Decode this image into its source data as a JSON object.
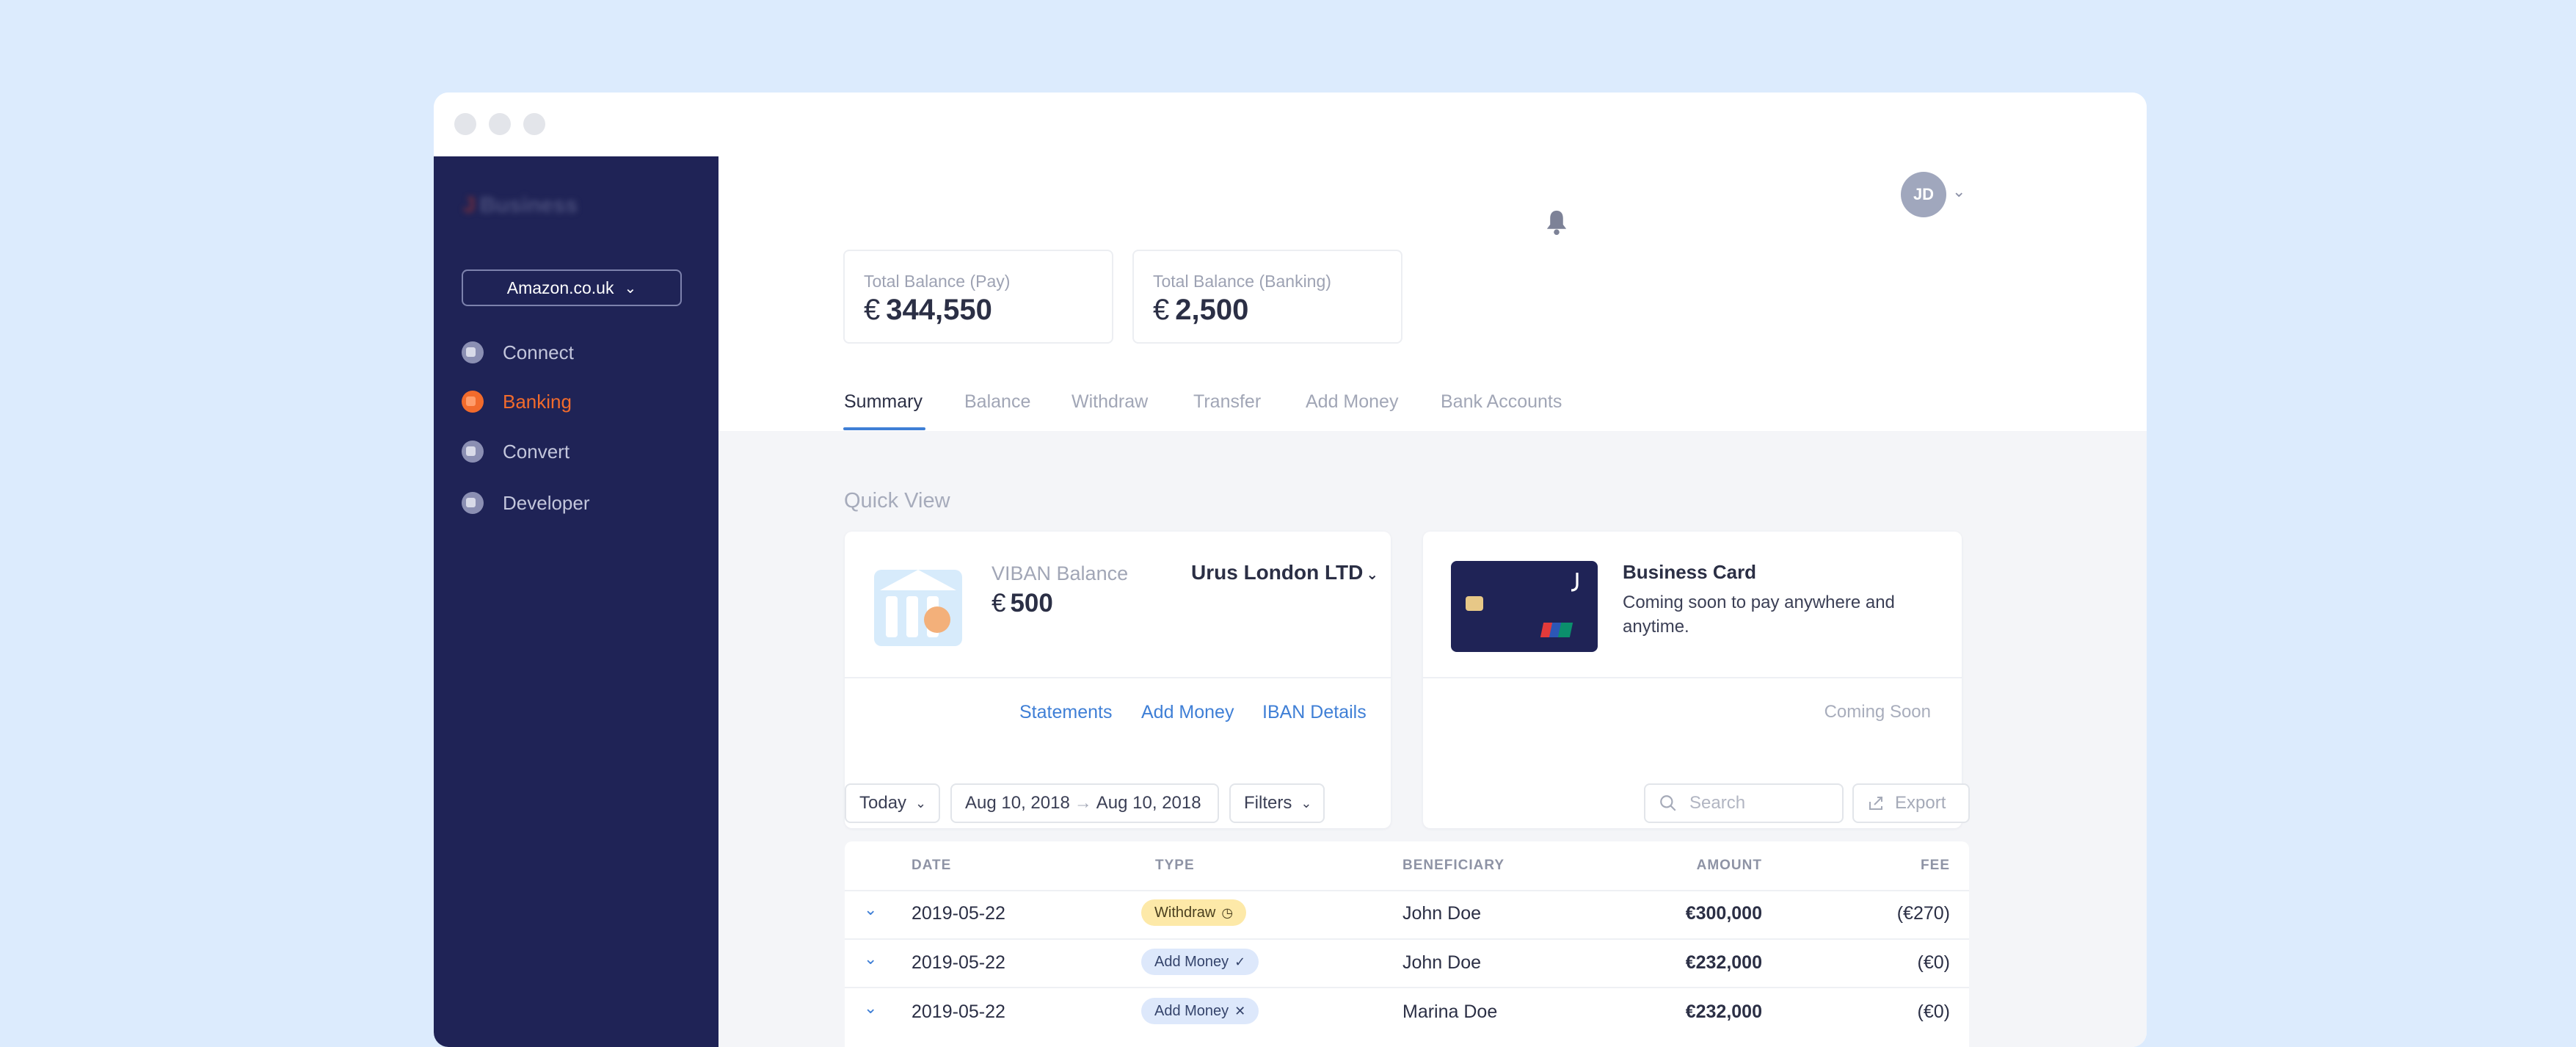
{
  "window": {
    "controls": [
      "close",
      "minimize",
      "maximize"
    ]
  },
  "sidebar": {
    "logo_text": "Business",
    "account_select": "Amazon.co.uk",
    "items": [
      {
        "label": "Connect",
        "icon": "connect-icon",
        "active": false
      },
      {
        "label": "Banking",
        "icon": "banking-icon",
        "active": true
      },
      {
        "label": "Convert",
        "icon": "convert-icon",
        "active": false
      },
      {
        "label": "Developer",
        "icon": "developer-icon",
        "active": false
      }
    ]
  },
  "header": {
    "notifications_icon": "bell-icon",
    "user_initials": "JD"
  },
  "balances": [
    {
      "label": "Total Balance (Pay)",
      "currency": "€",
      "value": "344,550"
    },
    {
      "label": "Total Balance (Banking)",
      "currency": "€",
      "value": "2,500"
    }
  ],
  "tabs": [
    {
      "label": "Summary",
      "active": true
    },
    {
      "label": "Balance",
      "active": false
    },
    {
      "label": "Withdraw",
      "active": false
    },
    {
      "label": "Transfer",
      "active": false
    },
    {
      "label": "Add Money",
      "active": false
    },
    {
      "label": "Bank Accounts",
      "active": false
    }
  ],
  "quick_view": {
    "title": "Quick View",
    "viban": {
      "label": "VIBAN Balance",
      "currency": "€",
      "value": "500",
      "account_name": "Urus London LTD",
      "links": [
        "Statements",
        "Add Money",
        "IBAN Details"
      ]
    },
    "business_card": {
      "title": "Business Card",
      "description": "Coming soon to pay anywhere and anytime.",
      "status": "Coming Soon"
    }
  },
  "filters": {
    "period": "Today",
    "date_from": "Aug 10, 2018",
    "date_to": "Aug 10, 2018",
    "filters_label": "Filters",
    "search_placeholder": "Search",
    "export_label": "Export"
  },
  "transactions": {
    "columns": [
      "DATE",
      "TYPE",
      "BENEFICIARY",
      "AMOUNT",
      "FEE"
    ],
    "rows": [
      {
        "date": "2019-05-22",
        "type": "Withdraw",
        "status": "pending",
        "beneficiary": "John Doe",
        "amount": "€300,000",
        "fee": "(€270)"
      },
      {
        "date": "2019-05-22",
        "type": "Add Money",
        "status": "completed",
        "beneficiary": "John Doe",
        "amount": "€232,000",
        "fee": "(€0)"
      },
      {
        "date": "2019-05-22",
        "type": "Add Money",
        "status": "failed",
        "beneficiary": "Marina Doe",
        "amount": "€232,000",
        "fee": "(€0)"
      }
    ]
  },
  "colors": {
    "sidebar_bg": "#1f2356",
    "accent": "#3f7fd6",
    "active_nav": "#f26b2c",
    "withdraw_badge": "#fde9a8",
    "addmoney_badge": "#dde8fb"
  }
}
